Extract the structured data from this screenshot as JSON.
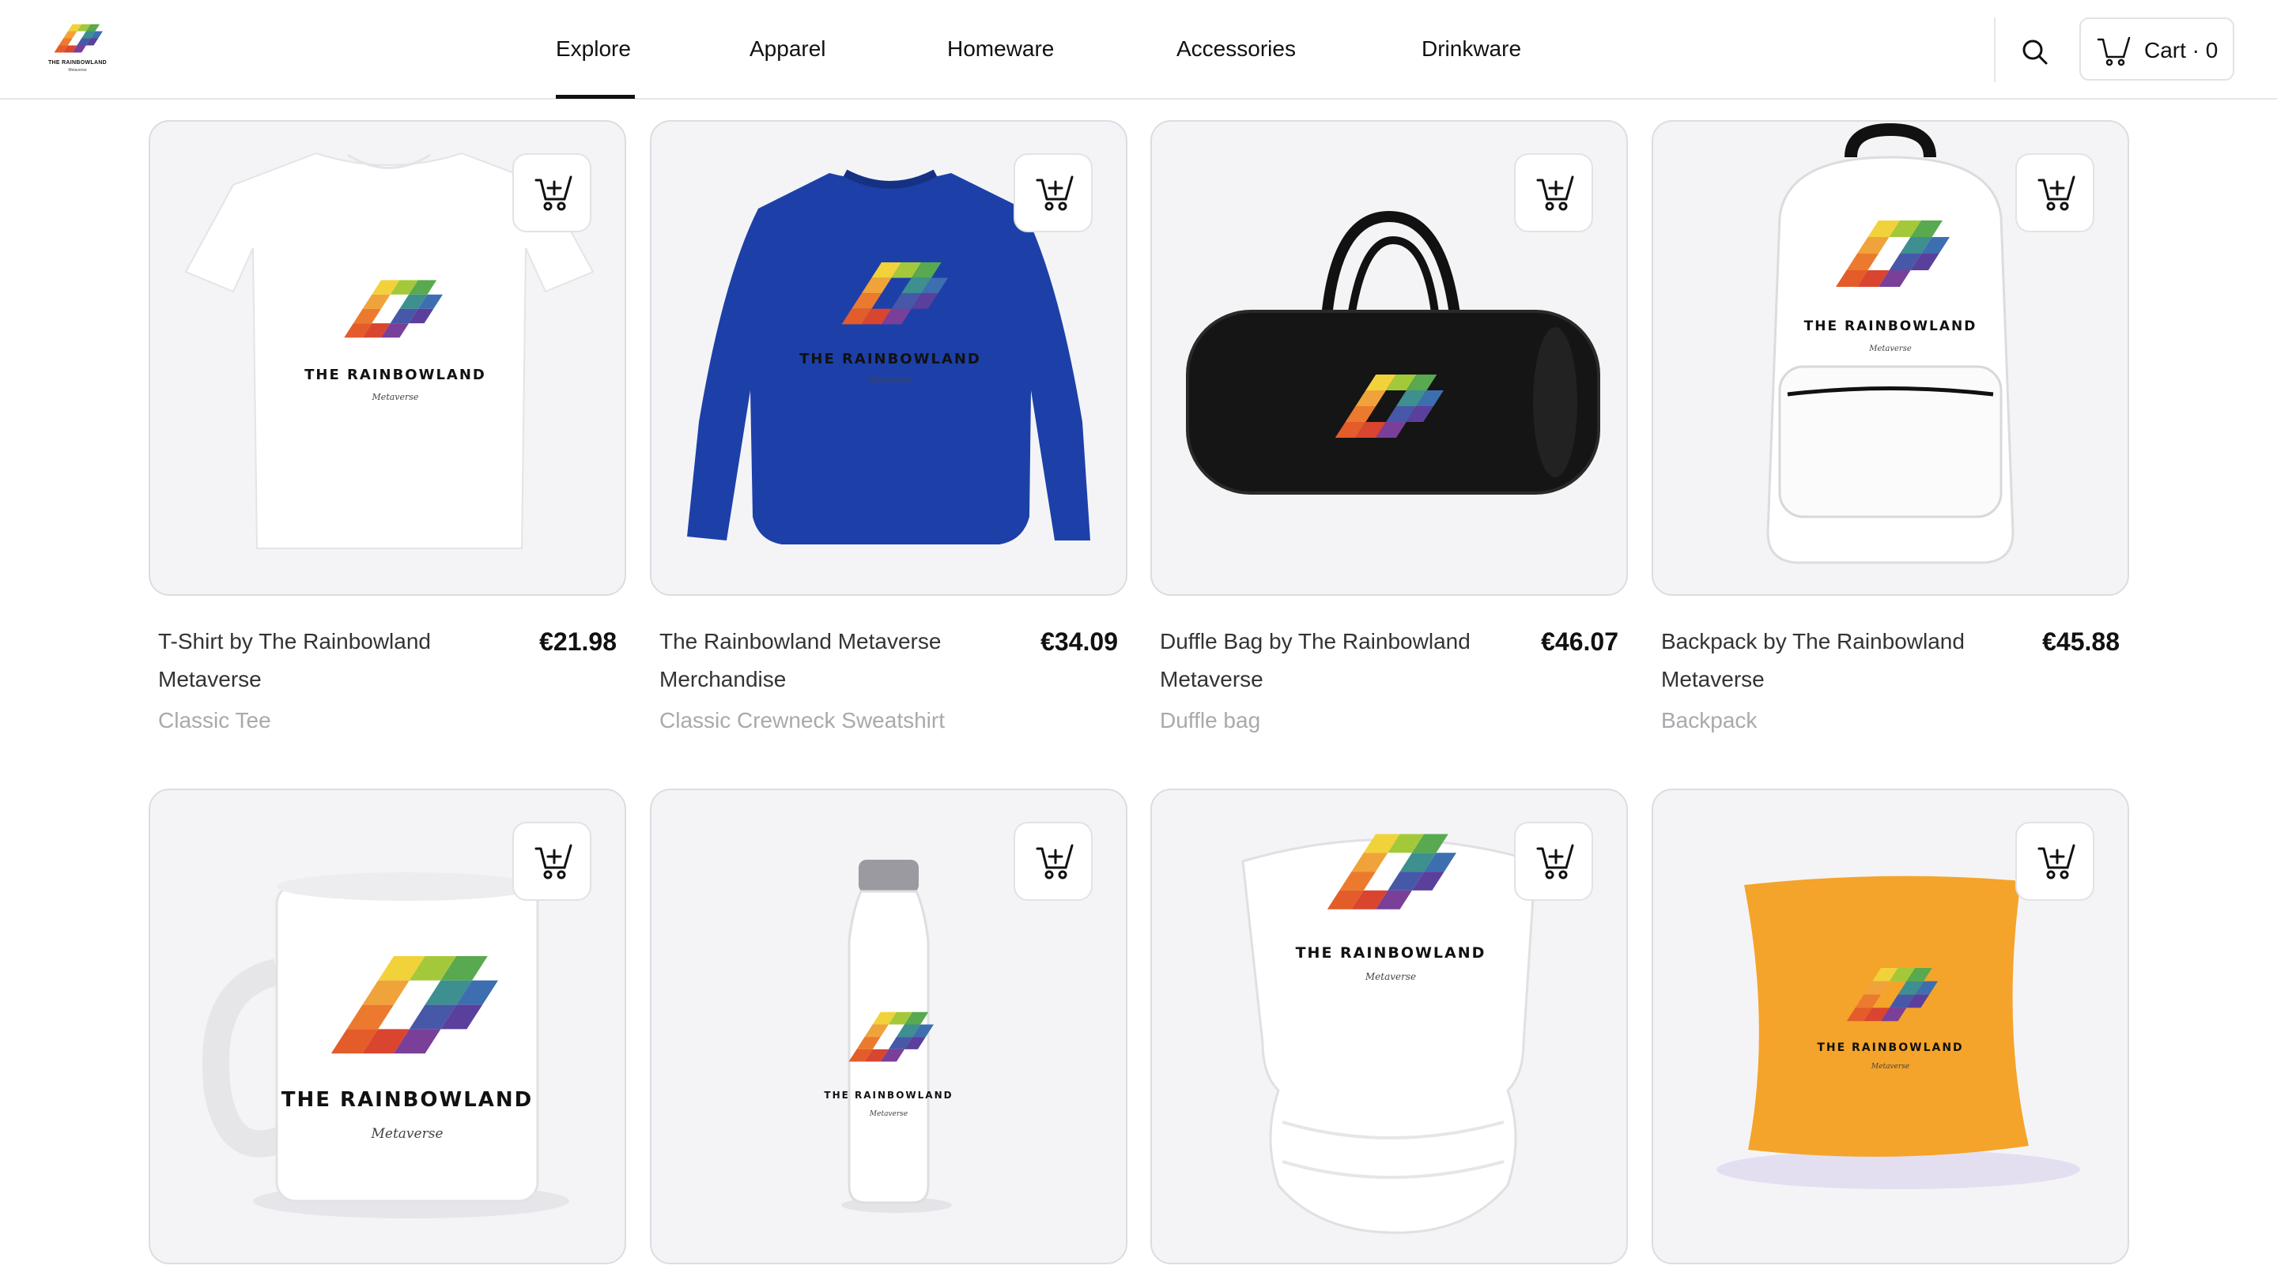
{
  "brand": {
    "logo_text": "THE RAINBOWLAND",
    "logo_sub": "Metaverse"
  },
  "nav": {
    "items": [
      "Explore",
      "Apparel",
      "Homeware",
      "Accessories",
      "Drinkware"
    ],
    "active": "Explore"
  },
  "cart": {
    "label": "Cart · 0",
    "count": 0
  },
  "icons": {
    "search": "search-icon",
    "cart": "cart-icon",
    "add_to_cart": "add-to-cart-icon"
  },
  "products": [
    {
      "name": "T-Shirt by The Rainbowland Metaverse",
      "price": "€21.98",
      "type": "Classic Tee",
      "color": "#ffffff"
    },
    {
      "name": "The Rainbowland Metaverse Merchandise",
      "price": "€34.09",
      "type": "Classic Crewneck Sweatshirt",
      "color": "#1d40a8"
    },
    {
      "name": "Duffle Bag by The Rainbowland Metaverse",
      "price": "€46.07",
      "type": "Duffle bag",
      "color": "#111111"
    },
    {
      "name": "Backpack by The Rainbowland Metaverse",
      "price": "€45.88",
      "type": "Backpack",
      "color": "#ffffff"
    },
    {
      "name": "",
      "price": "",
      "type": "",
      "color": "#ffffff"
    },
    {
      "name": "",
      "price": "",
      "type": "",
      "color": "#ffffff"
    },
    {
      "name": "",
      "price": "",
      "type": "",
      "color": "#ffffff"
    },
    {
      "name": "",
      "price": "",
      "type": "",
      "color": "#f4a42a"
    }
  ],
  "print": {
    "word": "THE RAINBOWLAND",
    "sub": "Metaverse"
  }
}
